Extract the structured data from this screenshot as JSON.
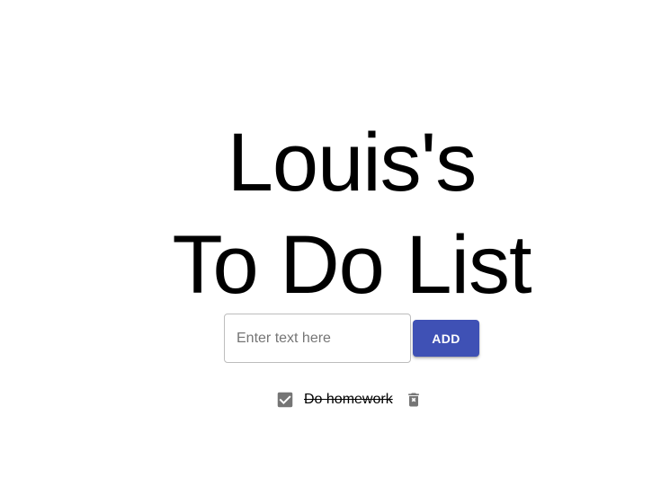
{
  "app": {
    "title_line1": "Louis's",
    "title_line2": "To Do List"
  },
  "input": {
    "placeholder": "Enter text here",
    "value": ""
  },
  "add_button": {
    "label": "ADD",
    "color": "#3f51b5"
  },
  "todos": [
    {
      "text": "Do homework",
      "completed": true,
      "check_icon": "checkbox-checked-icon",
      "delete_icon": "delete-icon"
    }
  ],
  "colors": {
    "icon": "#757575"
  }
}
